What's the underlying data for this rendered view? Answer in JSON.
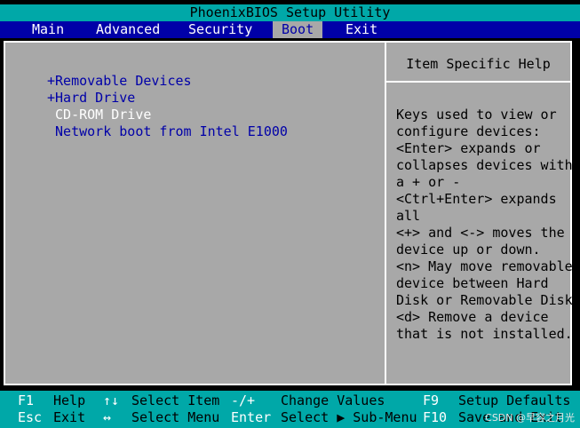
{
  "title": "PhoenixBIOS Setup Utility",
  "menu": {
    "main": "Main",
    "advanced": "Advanced",
    "security": "Security",
    "boot": "Boot",
    "exit": "Exit"
  },
  "boot_items": [
    "+Removable Devices",
    "+Hard Drive",
    " CD-ROM Drive",
    " Network boot from Intel E1000"
  ],
  "help": {
    "title": "Item Specific Help",
    "text": "Keys used to view or\nconfigure devices:\n<Enter> expands or\ncollapses devices with\na + or -\n<Ctrl+Enter> expands\nall\n<+> and <-> moves the\ndevice up or down.\n<n> May move removable\ndevice between Hard\nDisk or Removable Disk\n<d> Remove a device\nthat is not installed."
  },
  "footer": {
    "row1": {
      "k1": "F1",
      "d1": "Help",
      "k2": "↑↓",
      "d2": "Select Item",
      "k3": "-/+",
      "d3": "Change Values",
      "k4": "F9",
      "d4": "Setup Defaults"
    },
    "row2": {
      "k1": "Esc",
      "d1": "Exit",
      "k2": "↔",
      "d2": "Select Menu",
      "k3": "Enter",
      "d3": "Select ▶ Sub-Menu",
      "k4": "F10",
      "d4": "Save and Exit"
    }
  },
  "watermark": "CSDN @早容之月光",
  "colors": {
    "background": "#a8a8a8",
    "title_bar": "#00a8a8",
    "menu_bar": "#0000a8",
    "selected_text": "#ffffff",
    "item_text": "#0000a8"
  }
}
